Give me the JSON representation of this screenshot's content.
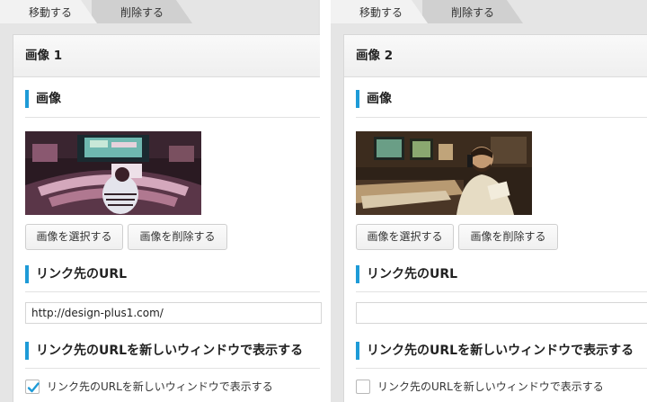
{
  "tabs": {
    "move": "移動する",
    "delete": "削除する"
  },
  "panels": [
    {
      "title": "画像 1",
      "image_section": "画像",
      "image_alt": "recording studio control room with mixing console",
      "select_button": "画像を選択する",
      "remove_button": "画像を削除する",
      "url_section": "リンク先のURL",
      "url_value": "http://design-plus1.com/",
      "newwindow_section": "リンク先のURLを新しいウィンドウで表示する",
      "newwindow_label": "リンク先のURLを新しいウィンドウで表示する",
      "newwindow_checked": true
    },
    {
      "title": "画像 2",
      "image_section": "画像",
      "image_alt": "man on phone in recording studio",
      "select_button": "画像を選択する",
      "remove_button": "画像を削除する",
      "url_section": "リンク先のURL",
      "url_value": "",
      "newwindow_section": "リンク先のURLを新しいウィンドウで表示する",
      "newwindow_label": "リンク先のURLを新しいウィンドウで表示する",
      "newwindow_checked": false
    }
  ],
  "colors": {
    "accent": "#1e9bd7",
    "check": "#1e9bd7"
  }
}
